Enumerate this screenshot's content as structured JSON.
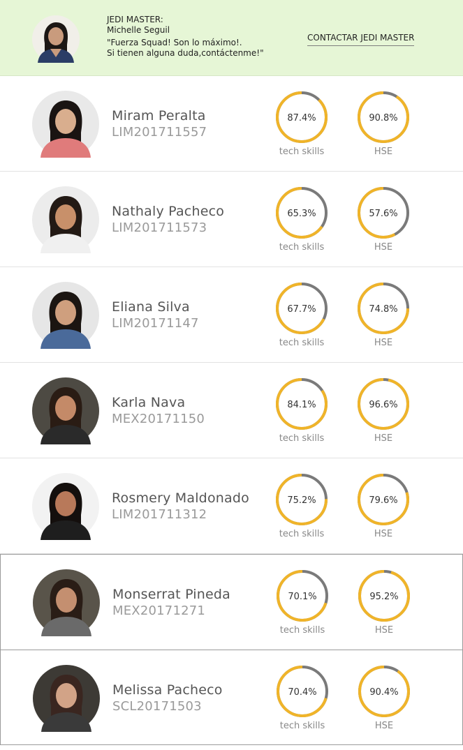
{
  "header": {
    "role": "JEDI MASTER:",
    "name": "Michelle Seguil",
    "quote": "\"Fuerza Squad! Son lo máximo!.\nSi tienen alguna duda,contáctenme!\"",
    "contact_label": "CONTACTAR JEDI MASTER"
  },
  "labels": {
    "tech": "tech skills",
    "hse": "HSE"
  },
  "colors": {
    "header_bg": "#e6f6d6",
    "ring_fill": "#f0b429",
    "ring_track": "#7a7a7a"
  },
  "students": [
    {
      "name": "Miram Peralta",
      "code": "LIM201711557",
      "tech": 87.4,
      "hse": 90.8,
      "tech_text": "87.4%",
      "hse_text": "90.8%"
    },
    {
      "name": "Nathaly Pacheco",
      "code": "LIM201711573",
      "tech": 65.3,
      "hse": 57.6,
      "tech_text": "65.3%",
      "hse_text": "57.6%"
    },
    {
      "name": "Eliana Silva",
      "code": "LIM20171147",
      "tech": 67.7,
      "hse": 74.8,
      "tech_text": "67.7%",
      "hse_text": "74.8%"
    },
    {
      "name": "Karla Nava",
      "code": "MEX20171150",
      "tech": 84.1,
      "hse": 96.6,
      "tech_text": "84.1%",
      "hse_text": "96.6%"
    },
    {
      "name": "Rosmery Maldonado",
      "code": "LIM201711312",
      "tech": 75.2,
      "hse": 79.6,
      "tech_text": "75.2%",
      "hse_text": "79.6%"
    },
    {
      "name": "Monserrat Pineda",
      "code": "MEX20171271",
      "tech": 70.1,
      "hse": 95.2,
      "tech_text": "70.1%",
      "hse_text": "95.2%"
    },
    {
      "name": "Melissa Pacheco",
      "code": "SCL20171503",
      "tech": 70.4,
      "hse": 90.4,
      "tech_text": "70.4%",
      "hse_text": "90.4%"
    }
  ]
}
